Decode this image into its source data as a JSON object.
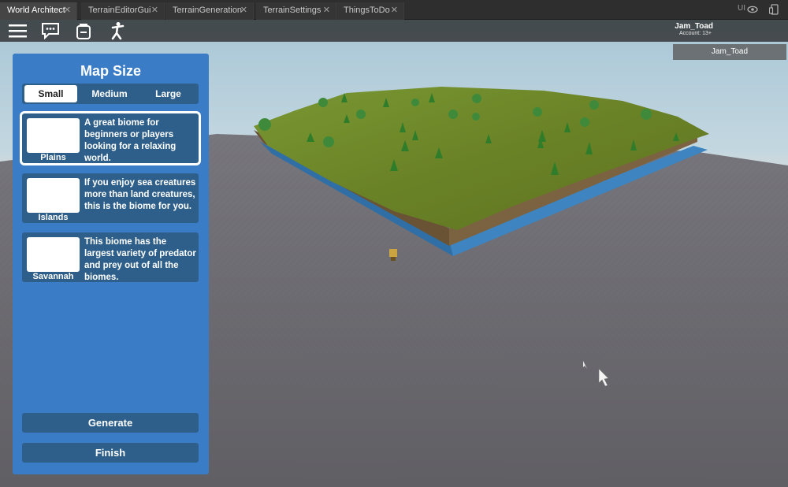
{
  "tabs": [
    {
      "label": "World Architect",
      "active": true
    },
    {
      "label": "TerrainEditorGui",
      "active": false
    },
    {
      "label": "TerrainGeneration",
      "active": false
    },
    {
      "label": "TerrainSettings",
      "active": false
    },
    {
      "label": "ThingsToDo",
      "active": false
    }
  ],
  "tab_close_glyph": "✕",
  "tabbar_right": {
    "ui_label": "UI"
  },
  "topbar": {
    "icons": [
      "menu-icon",
      "chat-icon",
      "backpack-icon",
      "emote-icon"
    ],
    "account": {
      "name": "Jam_Toad",
      "sub": "Account: 13+"
    }
  },
  "player_list": {
    "entry": "Jam_Toad"
  },
  "panel": {
    "title": "Map Size",
    "sizes": [
      {
        "label": "Small",
        "selected": true
      },
      {
        "label": "Medium",
        "selected": false
      },
      {
        "label": "Large",
        "selected": false
      }
    ],
    "biomes": [
      {
        "name": "Plains",
        "description": "A great biome for beginners or players looking for a relaxing world.",
        "selected": true
      },
      {
        "name": "Islands",
        "description": "If you enjoy sea creatures more than land creatures, this is the biome for you.",
        "selected": false
      },
      {
        "name": "Savannah",
        "description": "This biome has the largest variety of predator and prey out of all the biomes.",
        "selected": false
      }
    ],
    "generate_label": "Generate",
    "finish_label": "Finish"
  },
  "colors": {
    "panel": "#3a7cc5",
    "card": "#2e5f8a",
    "grass": "#6f8a2a",
    "water": "#3a78b0",
    "baseplate": "#6b6a6f"
  }
}
